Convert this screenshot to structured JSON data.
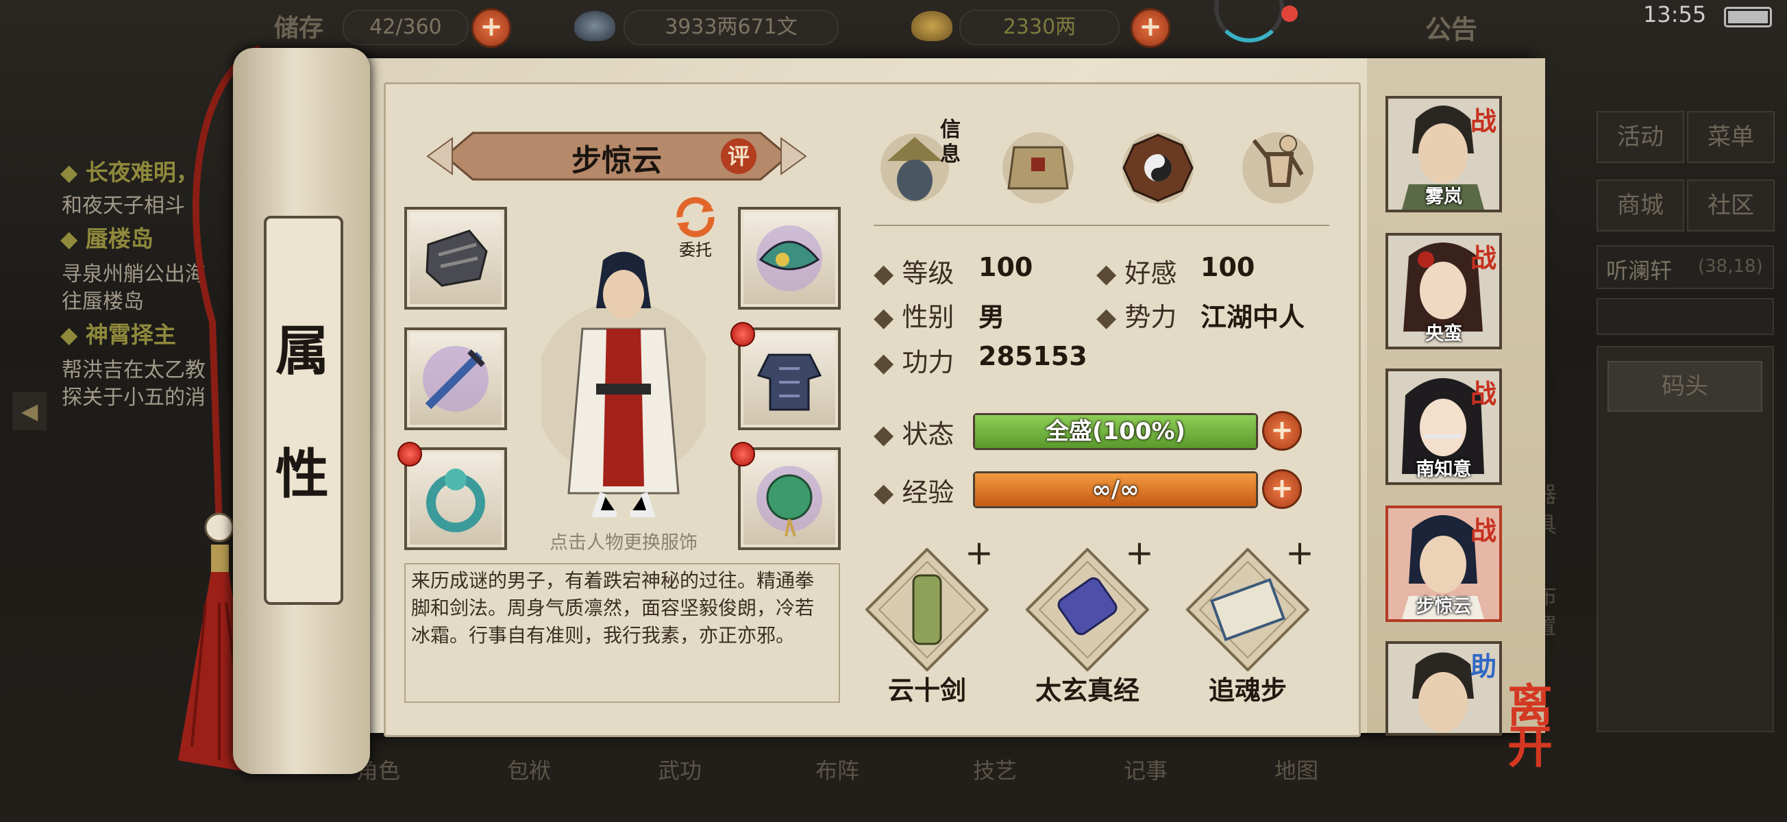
{
  "status_bar": {
    "time": "13:55"
  },
  "top_bar": {
    "capacity_label": "储存",
    "capacity_value": "42/360",
    "money": "3933两671文",
    "gold": "2330两",
    "notice": "公告"
  },
  "quests": [
    {
      "title": "长夜难明，",
      "lines": [
        "和夜天子相斗"
      ]
    },
    {
      "title": "蜃楼岛",
      "lines": [
        "寻泉州艄公出海",
        "往蜃楼岛"
      ]
    },
    {
      "title": "神霄择主",
      "lines": [
        "帮洪吉在太乙教",
        "探关于小五的消"
      ]
    }
  ],
  "right_menu": {
    "activity": "活动",
    "menu": "菜单",
    "mall": "商城",
    "community": "社区",
    "location": "听澜轩",
    "coords": "(38,18)",
    "dock": "码头",
    "side_chars": [
      "器",
      "具",
      "布",
      "置"
    ]
  },
  "bottom_tabs": [
    "角色",
    "包袱",
    "武功",
    "布阵",
    "技艺",
    "记事",
    "地图"
  ],
  "scroll": {
    "title_chars": [
      "属",
      "性"
    ]
  },
  "character": {
    "name": "步惊云",
    "rate_label": "评",
    "delegate_label": "委托",
    "change_outfit_hint": "点击人物更换服饰",
    "description": "来历成谜的男子，有着跌宕神秘的过往。精通拳脚和剑法。周身气质凛然，面容坚毅俊朗，冷若冰霜。行事自有准则，我行我素，亦正亦邪。"
  },
  "info_tabs": {
    "first_label": "信息"
  },
  "stats": {
    "level_label": "等级",
    "level": "100",
    "affinity_label": "好感",
    "affinity": "100",
    "gender_label": "性别",
    "gender": "男",
    "faction_label": "势力",
    "faction": "江湖中人",
    "power_label": "功力",
    "power": "285153",
    "status_label": "状态",
    "status_text": "全盛(100%)",
    "status_fraction": 1.0,
    "exp_label": "经验",
    "exp_text": "∞/∞",
    "exp_fraction": 1.0
  },
  "skills": [
    {
      "name": "云十剑"
    },
    {
      "name": "太玄真经"
    },
    {
      "name": "追魂步"
    }
  ],
  "party": [
    {
      "name": "雾岚",
      "badge": "战"
    },
    {
      "name": "央蛮",
      "badge": "战"
    },
    {
      "name": "南知意",
      "badge": "战"
    },
    {
      "name": "步惊云",
      "badge": "战",
      "active": true
    },
    {
      "name": "",
      "badge": "助"
    }
  ],
  "leave_label": "离开",
  "colors": {
    "status_bar": "#6fae3e",
    "exp_bar": "#e2792a",
    "accent_red": "#b33d1f"
  }
}
